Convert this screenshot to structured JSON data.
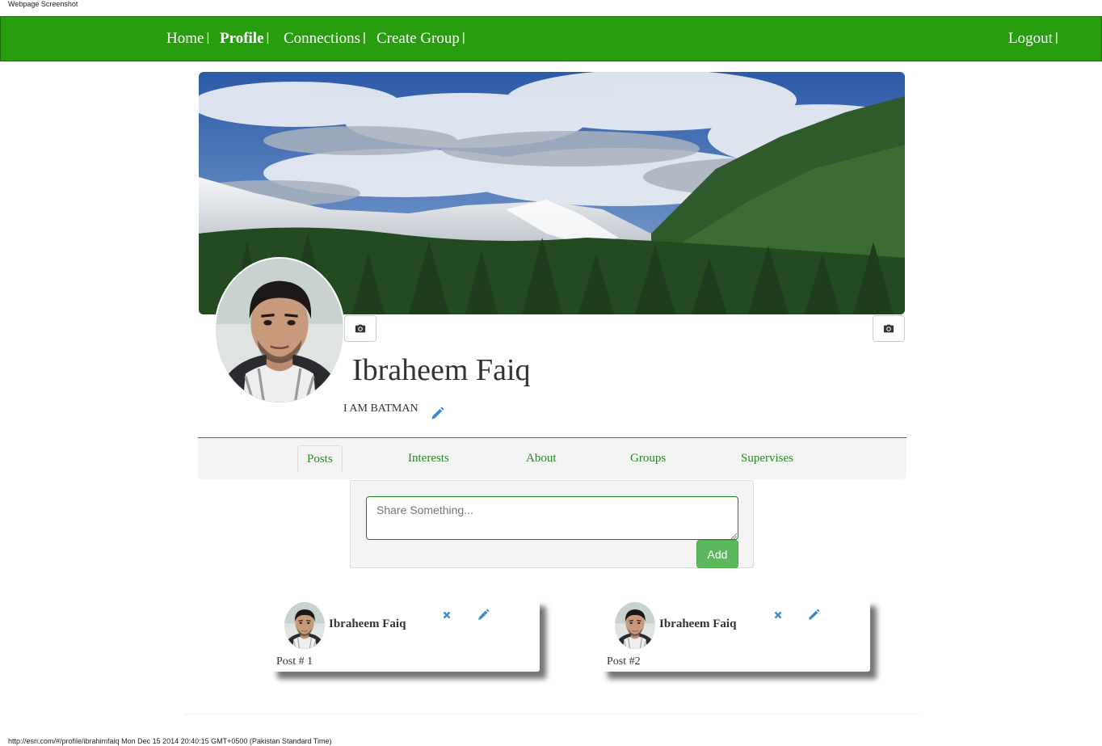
{
  "window": {
    "caption": "Webpage Screenshot"
  },
  "nav": {
    "items": [
      {
        "label": "Home"
      },
      {
        "label": "Profile"
      },
      {
        "label": "Connections"
      },
      {
        "label": "Create Group"
      }
    ],
    "logout_label": "Logout",
    "separator": "|",
    "background_color": "#289e0e"
  },
  "profile": {
    "name": "Ibraheem Faiq",
    "status": "I AM BATMAN",
    "cover_photo_icon": "camera-icon",
    "profile_photo_icon": "camera-icon",
    "edit_status_icon": "pencil-icon"
  },
  "tabs": {
    "items": [
      {
        "label": "Posts"
      },
      {
        "label": "Interests"
      },
      {
        "label": "About"
      },
      {
        "label": "Groups"
      },
      {
        "label": "Supervises"
      }
    ],
    "active": "Posts",
    "text_color": "#228b22"
  },
  "composer": {
    "placeholder": "Share Something...",
    "add_label": "Add",
    "button_color": "#5cb85c"
  },
  "posts": [
    {
      "author": "Ibraheem Faiq",
      "text": "Post # 1",
      "delete_icon": "close-icon",
      "edit_icon": "pencil-icon"
    },
    {
      "author": "Ibraheem Faiq",
      "text": "Post #2",
      "delete_icon": "close-icon",
      "edit_icon": "pencil-icon"
    }
  ],
  "footer": {
    "url_caption": "http://esn.com/#/profile/ibrahimfaiq Mon Dec 15 2014 20:40:15 GMT+0500 (Pakistan Standard Time)"
  }
}
